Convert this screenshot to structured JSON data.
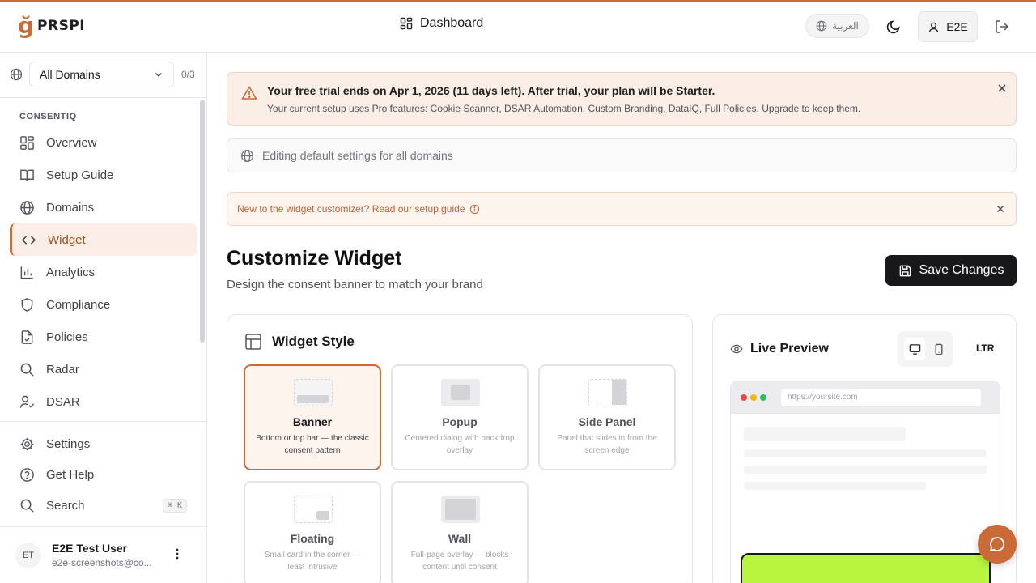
{
  "brand": {
    "logo_mark": "ğ",
    "logo_text": "PRSPI"
  },
  "header": {
    "title": "Dashboard",
    "language": "العربية",
    "user_short": "E2E"
  },
  "sidebar": {
    "domain_select": "All Domains",
    "domain_count": "0/3",
    "section": "CONSENTIQ",
    "items": [
      {
        "label": "Overview",
        "icon": "grid-icon"
      },
      {
        "label": "Setup Guide",
        "icon": "book-icon"
      },
      {
        "label": "Domains",
        "icon": "globe-icon"
      },
      {
        "label": "Widget",
        "icon": "code-icon",
        "active": true
      },
      {
        "label": "Analytics",
        "icon": "bar-chart-icon"
      },
      {
        "label": "Compliance",
        "icon": "shield-icon"
      },
      {
        "label": "Policies",
        "icon": "file-check-icon"
      },
      {
        "label": "Radar",
        "icon": "search-icon"
      },
      {
        "label": "DSAR",
        "icon": "user-check-icon"
      }
    ],
    "bottom_items": [
      {
        "label": "Settings",
        "icon": "gear-icon"
      },
      {
        "label": "Get Help",
        "icon": "help-circle-icon"
      },
      {
        "label": "Search",
        "icon": "search-icon",
        "shortcut": "⌘ K"
      }
    ],
    "user": {
      "initials": "ET",
      "name": "E2E Test User",
      "email": "e2e-screenshots@co..."
    }
  },
  "trial": {
    "title": "Your free trial ends on Apr 1, 2026 (11 days left). After trial, your plan will be Starter.",
    "subtitle": "Your current setup uses Pro features: Cookie Scanner, DSAR Automation, Custom Branding, DataIQ, Full Policies. Upgrade to keep them."
  },
  "editing_notice": "Editing default settings for all domains",
  "guide_notice": "New to the widget customizer? Read our setup guide",
  "page": {
    "title": "Customize Widget",
    "subtitle": "Design the consent banner to match your brand",
    "save_label": "Save Changes"
  },
  "widget_style": {
    "heading": "Widget Style",
    "options": [
      {
        "name": "Banner",
        "desc": "Bottom or top bar — the classic consent pattern",
        "selected": true
      },
      {
        "name": "Popup",
        "desc": "Centered dialog with backdrop overlay"
      },
      {
        "name": "Side Panel",
        "desc": "Panel that slides in from the screen edge"
      },
      {
        "name": "Floating",
        "desc": "Small card in the corner — least intrusive"
      },
      {
        "name": "Wall",
        "desc": "Full-page overlay — blocks content until consent"
      }
    ]
  },
  "preview": {
    "heading": "Live Preview",
    "direction": "LTR",
    "url": "https://yoursite.com"
  },
  "colors": {
    "accent": "#c96a37",
    "banner_preview": "#b9f53f",
    "dark": "#18181b"
  }
}
